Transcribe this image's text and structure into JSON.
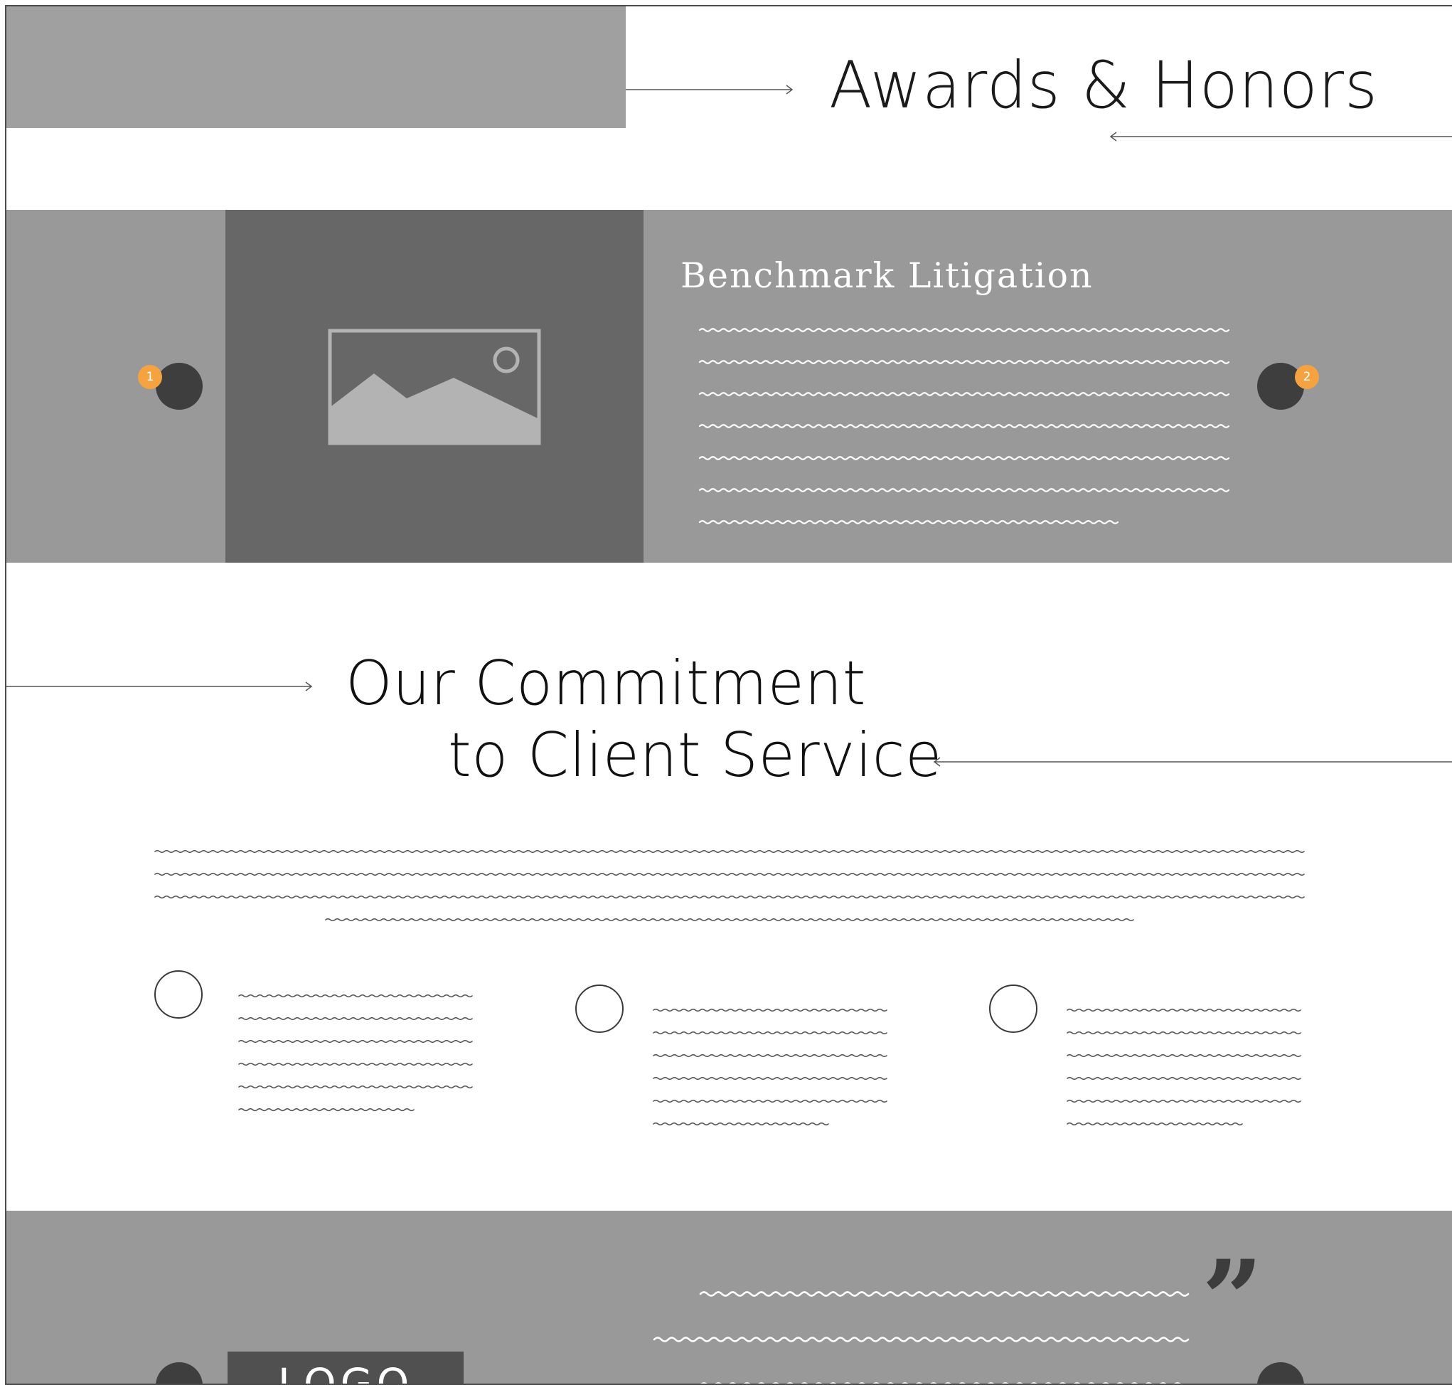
{
  "awards": {
    "title": "Awards & Honors"
  },
  "slider": {
    "slide_title": "Benchmark Litigation",
    "prev_badge": "1",
    "next_badge": "2",
    "image_icon": "image-placeholder-icon"
  },
  "commitment": {
    "title_line_1": "Our Commitment",
    "title_line_2": "to Client Service",
    "feature_icons": [
      "circle-icon",
      "circle-icon",
      "circle-icon"
    ]
  },
  "testimonial": {
    "logo_text": "LOGO",
    "quote_icon": "quote-icon",
    "quote_mark": "”"
  },
  "colors": {
    "band_gray": "#999999",
    "image_gray": "#676767",
    "top_block_gray": "#a0a0a0",
    "badge_orange": "#f4a340",
    "dot_dark": "#3e3e3e"
  }
}
